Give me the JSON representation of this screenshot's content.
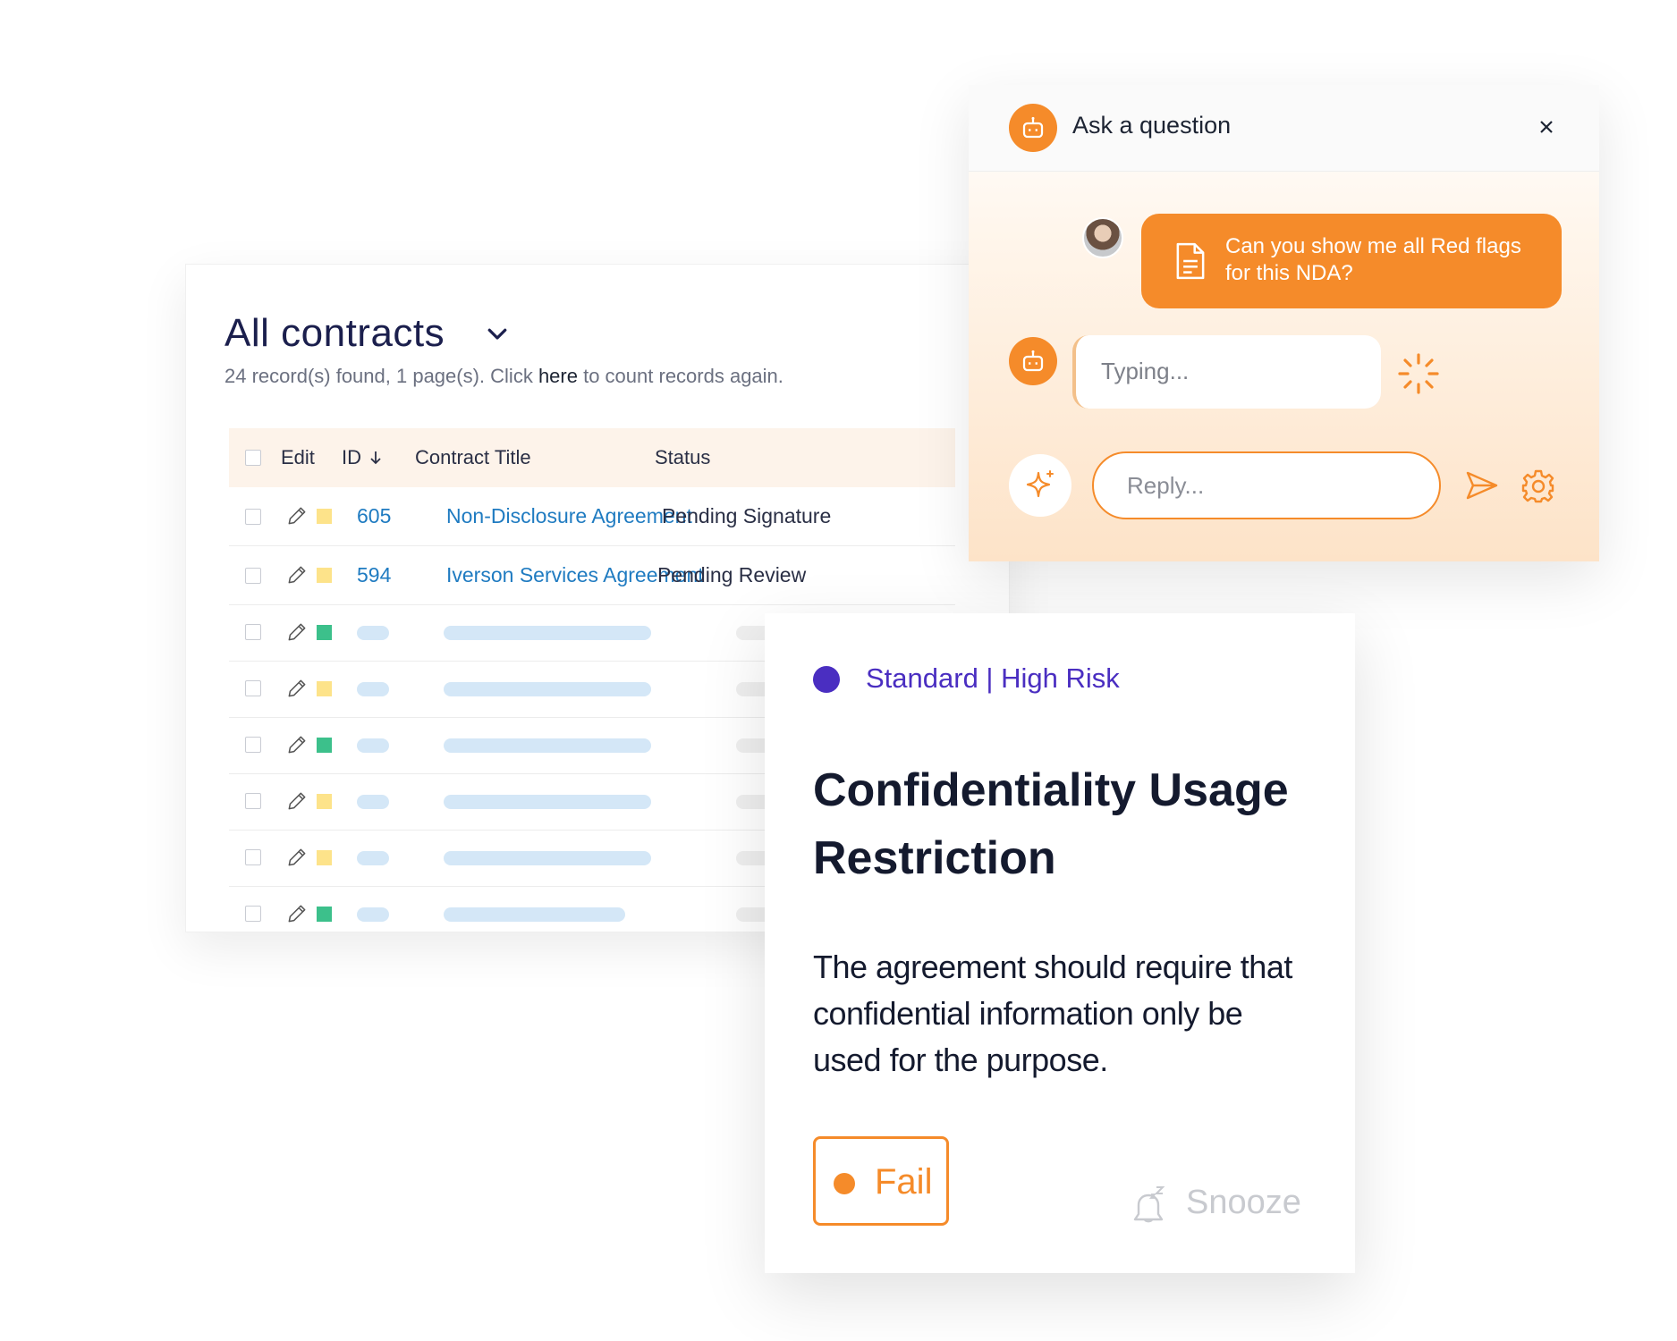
{
  "contracts": {
    "title": "All contracts",
    "records_prefix": "24 record(s) found, 1 page(s). Click ",
    "records_link": "here",
    "records_suffix": " to count records again.",
    "columns": {
      "edit": "Edit",
      "id": "ID",
      "title": "Contract Title",
      "status": "Status"
    },
    "rows": [
      {
        "id": "605",
        "title": "Non-Disclosure Agreement",
        "status": "Pending Signature",
        "flag": "yellow"
      },
      {
        "id": "594",
        "title": "Iverson Services Agreement",
        "status": "Pending Review",
        "flag": "yellow"
      }
    ],
    "placeholder_row_flags": [
      "green",
      "yellow",
      "green",
      "yellow",
      "yellow",
      "green"
    ]
  },
  "chat": {
    "title": "Ask a question",
    "user_message": "Can you show me all Red flags for this NDA?",
    "typing": "Typing...",
    "reply_placeholder": "Reply..."
  },
  "risk_card": {
    "label": "Standard | High Risk",
    "title": "Confidentiality Usage Restriction",
    "description": "The agreement should require that confidential information only be used for the purpose.",
    "result": "Fail",
    "snooze": "Snooze"
  },
  "colors": {
    "accent": "#f58b2a",
    "link": "#1f7bc1",
    "risk": "#4a2ec1",
    "flag_yellow": "#fde38a",
    "flag_green": "#3cc08b",
    "skeleton": "#d4e7f7"
  },
  "icons": {
    "header": "chevron-down-icon",
    "sort": "arrow-down-icon",
    "row_edit": "pencil-icon",
    "bot": "robot-icon",
    "close": "close-icon",
    "message": "document-icon",
    "loading": "spinner-icon",
    "ai": "sparkle-icon",
    "send": "send-icon",
    "settings": "gear-icon",
    "snooze": "snooze-bell-icon"
  }
}
